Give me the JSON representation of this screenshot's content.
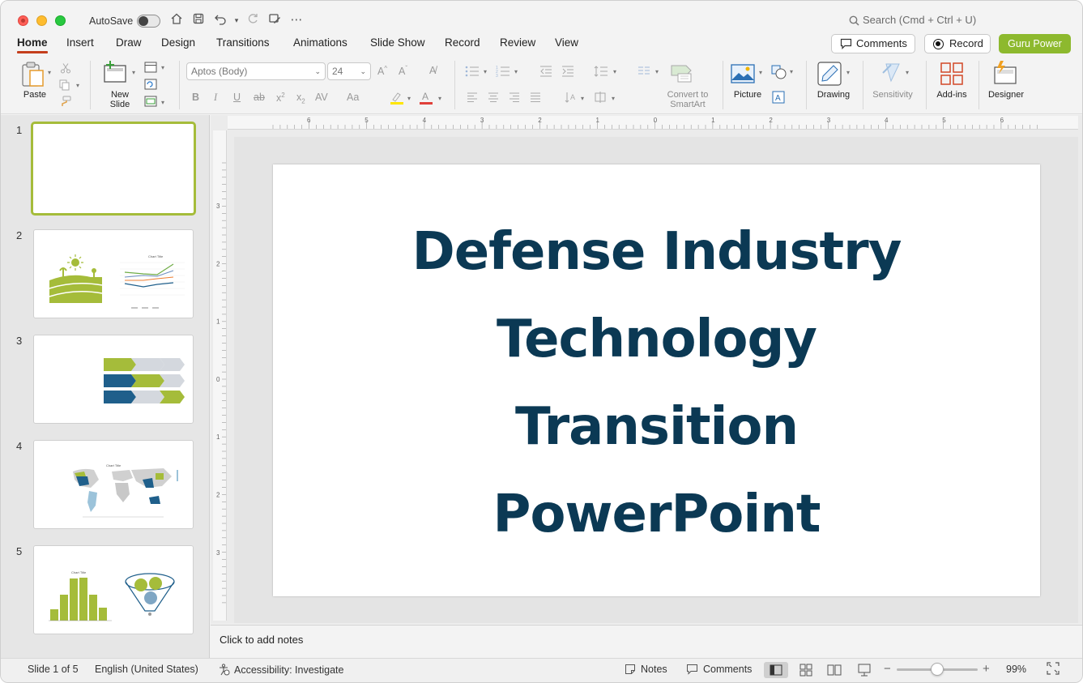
{
  "titlebar": {
    "autosave_label": "AutoSave",
    "search_placeholder": "Search (Cmd + Ctrl + U)"
  },
  "tabs": [
    "Home",
    "Insert",
    "Draw",
    "Design",
    "Transitions",
    "Animations",
    "Slide Show",
    "Record",
    "Review",
    "View"
  ],
  "header_buttons": {
    "comments": "Comments",
    "record": "Record",
    "guru": "Guru Power"
  },
  "ribbon": {
    "paste": "Paste",
    "new_slide": "New\nSlide",
    "font_name": "Aptos (Body)",
    "font_size": "24",
    "convert_smartart_1": "Convert to",
    "convert_smartart_2": "SmartArt",
    "picture": "Picture",
    "drawing": "Drawing",
    "sensitivity": "Sensitivity",
    "addins": "Add-ins",
    "designer": "Designer"
  },
  "slides_panel": {
    "numbers": [
      "1",
      "2",
      "3",
      "4",
      "5"
    ],
    "thumb2_chart_title": "Chart Title",
    "thumb4_chart_title": "Chart Title",
    "thumb5_chart_title": "Chart Title"
  },
  "slide": {
    "title_lines": [
      "Defense Industry",
      "Technology",
      "Transition",
      "PowerPoint"
    ],
    "title_color": "#0b3954"
  },
  "notes": {
    "placeholder": "Click to add notes"
  },
  "ruler": {
    "h_labels": [
      "6",
      "5",
      "4",
      "3",
      "2",
      "1",
      "0",
      "1",
      "2",
      "3",
      "4",
      "5",
      "6"
    ],
    "v_labels": [
      "3",
      "2",
      "1",
      "0",
      "1",
      "2",
      "3"
    ]
  },
  "status": {
    "slide_of": "Slide 1 of 5",
    "language": "English (United States)",
    "accessibility": "Accessibility: Investigate",
    "notes": "Notes",
    "comments": "Comments",
    "zoom": "99%"
  },
  "colors": {
    "accent_green": "#8db92e",
    "tab_underline": "#c43e1c",
    "navy": "#0b3954",
    "thumb_blue": "#1f5f8b"
  }
}
